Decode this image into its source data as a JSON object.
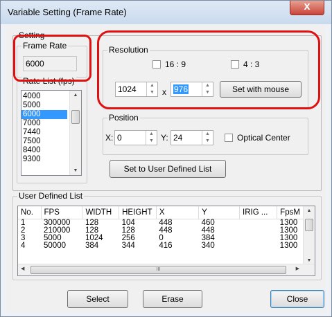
{
  "window": {
    "title": "Variable Setting (Frame Rate)",
    "close_glyph": "X"
  },
  "setting": {
    "group_label": "Setting",
    "frame_rate": {
      "label": "Frame Rate",
      "value": "6000"
    },
    "rate_list": {
      "label": "Rate List (fps)",
      "items": [
        "4000",
        "5000",
        "6000",
        "7000",
        "7440",
        "7500",
        "8400",
        "9300"
      ],
      "selected": "6000"
    },
    "resolution": {
      "label": "Resolution",
      "aspect_16_9": "16 : 9",
      "aspect_4_3": "4 : 3",
      "width": "1024",
      "x_sep": "x",
      "height": "976",
      "set_with_mouse": "Set with mouse"
    },
    "position": {
      "label": "Position",
      "x_label": "X:",
      "x_value": "0",
      "y_label": "Y:",
      "y_value": "24",
      "optical_center": "Optical Center"
    },
    "set_user_list": "Set to User Defined List"
  },
  "user_list": {
    "label": "User Defined List",
    "columns": [
      "No.",
      "FPS",
      "WIDTH",
      "HEIGHT",
      "X",
      "Y",
      "IRIG ...",
      "FpsM"
    ],
    "rows": [
      [
        "1",
        "300000",
        "128",
        "104",
        "448",
        "460",
        "",
        "1300"
      ],
      [
        "2",
        "210000",
        "128",
        "128",
        "448",
        "448",
        "",
        "1300"
      ],
      [
        "3",
        "5000",
        "1024",
        "256",
        "0",
        "384",
        "",
        "1300"
      ],
      [
        "4",
        "50000",
        "384",
        "344",
        "416",
        "340",
        "",
        "1300"
      ]
    ],
    "hscroll_grip": "III"
  },
  "buttons": {
    "select": "Select",
    "erase": "Erase",
    "close": "Close"
  },
  "icons": {
    "up": "▲",
    "down": "▼",
    "left": "◀",
    "right": "▶"
  },
  "colors": {
    "highlight": "#3399ff",
    "annotation": "#e01010"
  }
}
